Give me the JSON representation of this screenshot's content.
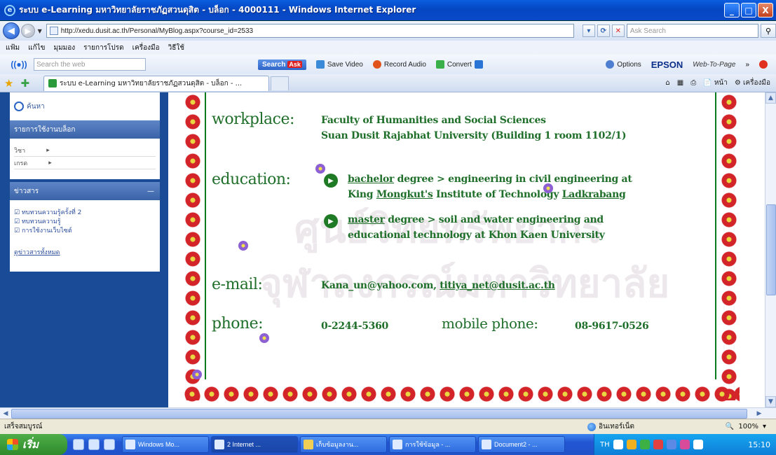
{
  "window": {
    "title": "ระบบ e-Learning มหาวิทยาลัยราชภัฏสวนดุสิต - บล็อก - 4000111 - Windows Internet Explorer",
    "btn_min": "_",
    "btn_max": "□",
    "btn_close": "X"
  },
  "address_bar": {
    "url": "http://xedu.dusit.ac.th/Personal/MyBlog.aspx?course_id=2533",
    "search_placeholder": "Ask Search"
  },
  "menu": {
    "items": [
      "แฟ้ม",
      "แก้ไข",
      "มุมมอง",
      "รายการโปรด",
      "เครื่องมือ",
      "วิธีใช้"
    ]
  },
  "toolbar": {
    "search_placeholder": "Search the web",
    "search_label": "Search",
    "search_badge": "Ask",
    "save_video": "Save Video",
    "record_audio": "Record Audio",
    "convert": "Convert",
    "options": "Options",
    "epson": "EPSON",
    "web_to_page": "Web-To-Page",
    "more": "»"
  },
  "tabs": {
    "active_title": "ระบบ e-Learning มหาวิทยาลัยราชภัฏสวนดุสิต - บล็อก - ...",
    "page_label": "หน้า",
    "tools_label": "เครื่องมือ"
  },
  "sidebar": {
    "search_label": "ค้นหา",
    "services_header": "รายการใช้งานบล็อก",
    "services": [
      "วิชา",
      "เกรด"
    ],
    "news_header": "ข่าวสาร",
    "news_items": [
      "ทบทวนความรู้ครั้งที่ 2",
      "ทบทวนความรู้",
      "การใช้งานเว็บไซต์"
    ],
    "news_all": "ดูข่าวสารทั้งหมด"
  },
  "profile": {
    "workplace_label": "workplace:",
    "workplace_line1": "Faculty of Humanities and Social Sciences",
    "workplace_line2": "Suan Dusit Rajabhat University (Building 1 room 1102/1)",
    "education_label": "education:",
    "edu1_degree": "bachelor",
    "edu1_rest_line1": " degree >  engineering in civil engineering at",
    "edu1_inst_a": "King ",
    "edu1_inst_b": "Mongkut's",
    "edu1_inst_c": " Institute of Technology ",
    "edu1_inst_d": "Ladkrabang",
    "edu2_degree": "master",
    "edu2_rest_line1": " degree > soil and water engineering and",
    "edu2_line2": "educational technology at Khon Kaen University",
    "email_label": "e-mail:",
    "email_1": "Kana_un@yahoo.com,",
    "email_2": "titiya_net@dusit.ac.th",
    "phone_label": "phone:",
    "phone_value": "0-2244-5360",
    "mobile_label": "mobile phone:",
    "mobile_value": "08-9617-0526"
  },
  "watermark": {
    "line1": "ศูนย์วิทยทรัพยากร",
    "line2": "จุฬาลงกรณ์มหาวิทยาลัย"
  },
  "statusbar": {
    "left": "เสร็จสมบูรณ์",
    "zone": "อินเทอร์เน็ต",
    "zoom": "100%"
  },
  "taskbar": {
    "start": "เริ่ม",
    "tasks": [
      "Windows Mo...",
      "2 Internet ...",
      "เก็บข้อมูลงาน...",
      "การใช้ข้อมูล - ...",
      "Document2 - ..."
    ],
    "lang": "TH",
    "clock": "15:10"
  }
}
